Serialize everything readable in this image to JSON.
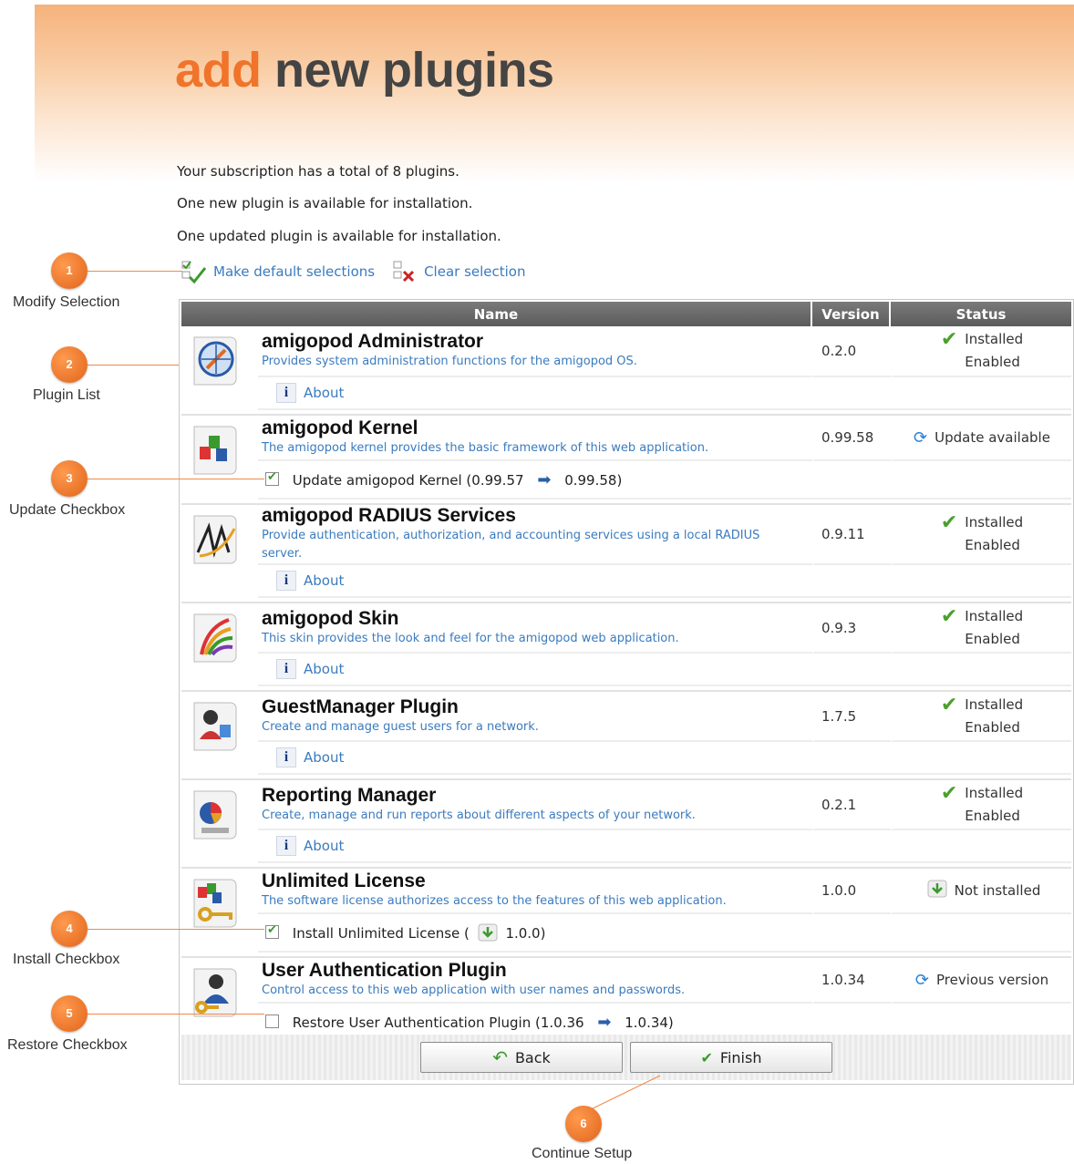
{
  "header": {
    "title_accent": "add",
    "title_main": "new plugins"
  },
  "intro": {
    "line1": "Your subscription has a total of 8 plugins.",
    "line2": "One new plugin is available for installation.",
    "line3": "One updated plugin is available for installation."
  },
  "toolbar": {
    "default_label": "Make default selections",
    "clear_label": "Clear selection"
  },
  "table": {
    "headers": {
      "name": "Name",
      "version": "Version",
      "status": "Status"
    },
    "about_label": "About",
    "plugins": [
      {
        "name": "amigopod Administrator",
        "desc": "Provides system administration functions for the amigopod OS.",
        "version": "0.2.0",
        "status1": "Installed",
        "status2": "Enabled"
      },
      {
        "name": "amigopod Kernel",
        "desc": "The amigopod kernel provides the basic framework of this web application.",
        "version": "0.99.58",
        "status1": "Update available",
        "option_label": "Update amigopod Kernel (0.99.57",
        "option_to": "0.99.58)"
      },
      {
        "name": "amigopod RADIUS Services",
        "desc": "Provide authentication, authorization, and accounting services using a local RADIUS server.",
        "version": "0.9.11",
        "status1": "Installed",
        "status2": "Enabled"
      },
      {
        "name": "amigopod Skin",
        "desc": "This skin provides the look and feel for the amigopod web application.",
        "version": "0.9.3",
        "status1": "Installed",
        "status2": "Enabled"
      },
      {
        "name": "GuestManager Plugin",
        "desc": "Create and manage guest users for a network.",
        "version": "1.7.5",
        "status1": "Installed",
        "status2": "Enabled"
      },
      {
        "name": "Reporting Manager",
        "desc": "Create, manage and run reports about different aspects of your network.",
        "version": "0.2.1",
        "status1": "Installed",
        "status2": "Enabled"
      },
      {
        "name": "Unlimited License",
        "desc": "The software license authorizes access to the features of this web application.",
        "version": "1.0.0",
        "status1": "Not installed",
        "option_label": "Install Unlimited License (",
        "option_to": "1.0.0)"
      },
      {
        "name": "User Authentication Plugin",
        "desc": "Control access to this web application with user names and passwords.",
        "version": "1.0.34",
        "status1": "Previous version",
        "option_label": "Restore User Authentication Plugin (1.0.36",
        "option_to": "1.0.34)"
      }
    ]
  },
  "buttons": {
    "back": "Back",
    "finish": "Finish"
  },
  "callouts": {
    "c1": {
      "num": "1",
      "label": "Modify Selection"
    },
    "c2": {
      "num": "2",
      "label": "Plugin List"
    },
    "c3": {
      "num": "3",
      "label": "Update Checkbox"
    },
    "c4": {
      "num": "4",
      "label": "Install Checkbox"
    },
    "c5": {
      "num": "5",
      "label": "Restore Checkbox"
    },
    "c6": {
      "num": "6",
      "label": "Continue Setup"
    }
  },
  "colors": {
    "accent": "#f0742a",
    "link": "#3a7bbf",
    "header_gray": "#5b5b5b",
    "check_green": "#4aa02c",
    "callout": "#e0641a"
  }
}
